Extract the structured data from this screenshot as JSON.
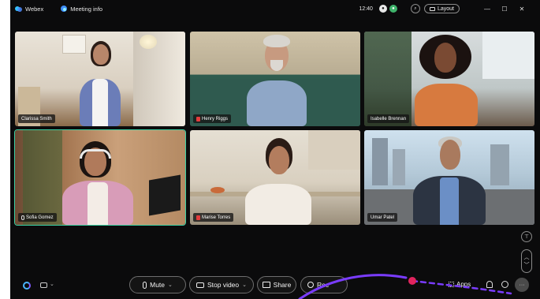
{
  "titlebar": {
    "app_name": "Webex",
    "meeting_info": "Meeting info",
    "time": "12:40",
    "layout_label": "Layout",
    "window_controls": {
      "minimize": "—",
      "maximize": "☐",
      "close": "✕"
    }
  },
  "participants": [
    {
      "name": "Clarissa Smith",
      "muted": false
    },
    {
      "name": "Henry Riggs",
      "muted": true
    },
    {
      "name": "Isabelle Brennan",
      "muted": false
    },
    {
      "name": "Sofia Gomez",
      "muted": false,
      "active_speaker": true
    },
    {
      "name": "Marise Torres",
      "muted": true
    },
    {
      "name": "Umar Patel",
      "muted": false
    }
  ],
  "controls": {
    "mute": "Mute",
    "stop_video": "Stop video",
    "share": "Share",
    "record": "Rec",
    "apps": "Apps",
    "more": "···",
    "chevron": "⌄"
  },
  "side_controls": {
    "top": "⊤",
    "up": "︿",
    "down": "﹀"
  },
  "colors": {
    "accent": "#3bd1a4",
    "annotation": "#7a3cff",
    "end_marker": "#e0245e"
  },
  "icons": [
    "webex-icon",
    "meeting-info-icon",
    "mic-icon",
    "recording-icon",
    "search-icon",
    "layout-icon",
    "ai-assistant-icon",
    "chat-icon",
    "camera-icon",
    "share-icon",
    "record-icon",
    "apps-icon",
    "participants-icon",
    "chat-bubble-icon"
  ]
}
